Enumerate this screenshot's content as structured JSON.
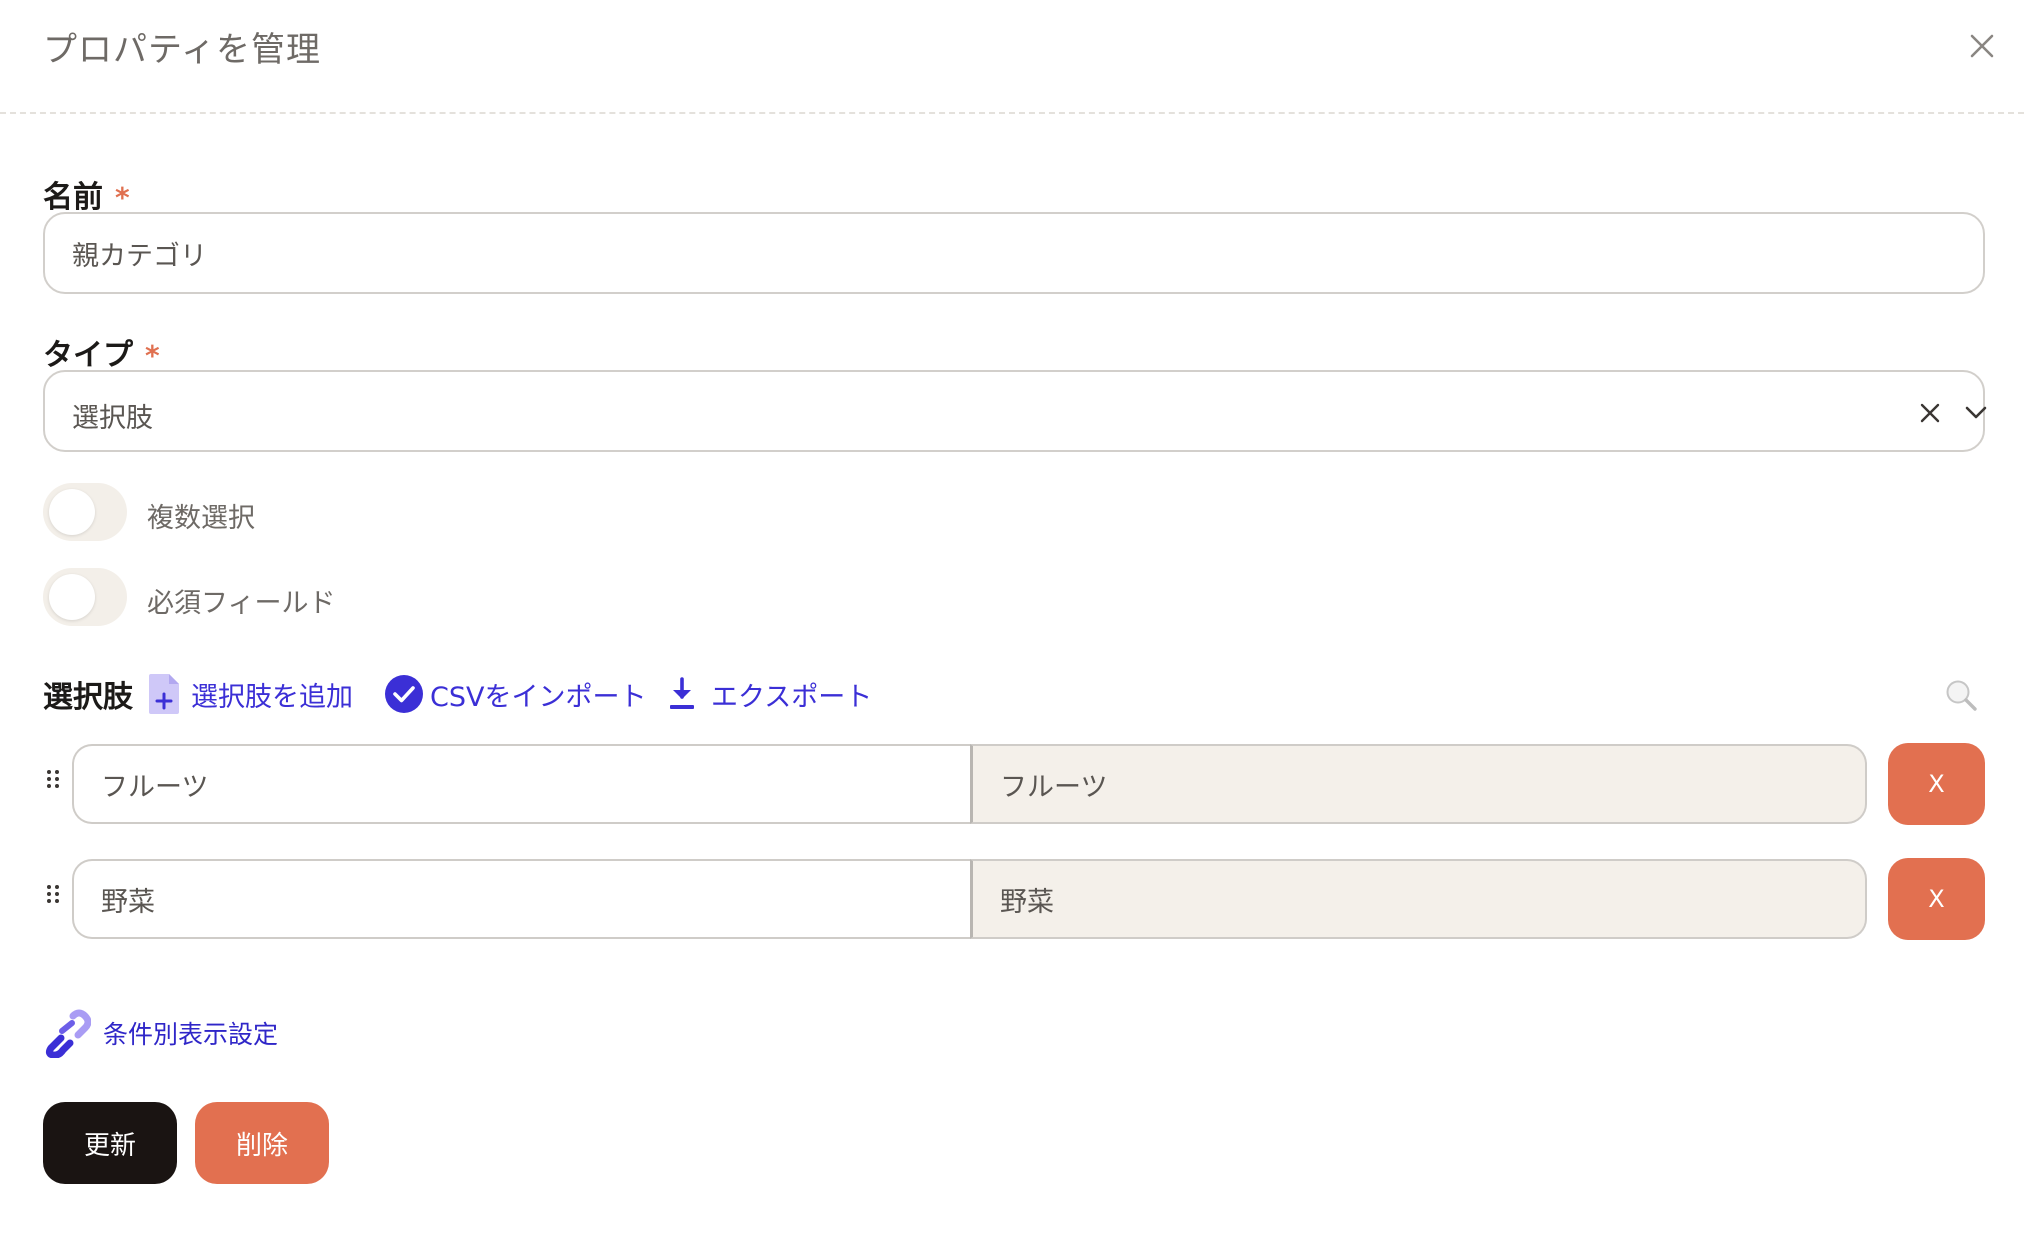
{
  "dialog": {
    "title": "プロパティを管理"
  },
  "form": {
    "name_label": "名前",
    "required_mark": "*",
    "name_value": "親カテゴリ",
    "type_label": "タイプ",
    "type_value": "選択肢",
    "multi_select_label": "複数選択",
    "multi_select_on": false,
    "required_field_label": "必須フィールド",
    "required_field_on": false
  },
  "options": {
    "title": "選択肢",
    "add_label": "選択肢を追加",
    "import_label": "CSVをインポート",
    "export_label": "エクスポート",
    "delete_label": "X",
    "rows": [
      {
        "value": "フルーツ",
        "label": "フルーツ"
      },
      {
        "value": "野菜",
        "label": "野菜"
      }
    ]
  },
  "conditional": {
    "label": "条件別表示設定"
  },
  "footer": {
    "update_label": "更新",
    "delete_label": "削除"
  },
  "colors": {
    "accent": "#3b2fd6",
    "danger": "#e27050",
    "primary_dark": "#1a1412",
    "toggle_off": "#f3efe9",
    "readonly_field": "#f4f0ea"
  },
  "icons": {
    "close": "close-icon",
    "clear": "clear-icon",
    "caret": "chevron-down-icon",
    "add": "add-file-icon",
    "import": "check-circle-icon",
    "export": "download-icon",
    "search": "search-icon",
    "drag": "drag-handle-icon",
    "link": "link-icon"
  }
}
